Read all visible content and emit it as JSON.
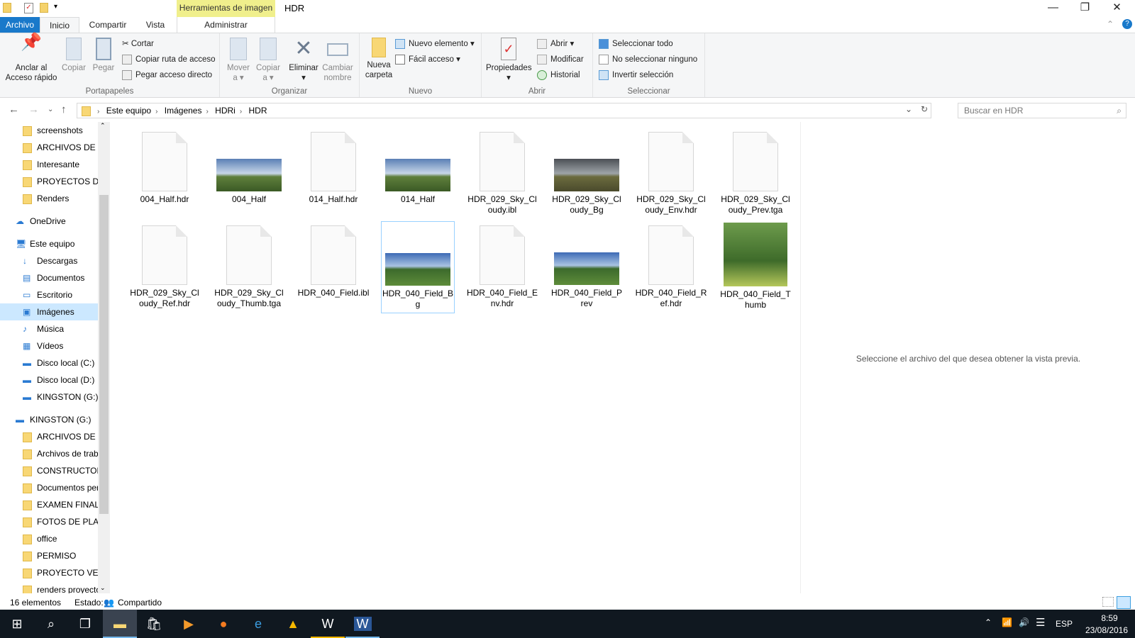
{
  "window": {
    "title": "HDR",
    "context_tab": "Herramientas de imagen",
    "min": "—",
    "max": "❐",
    "close": "✕"
  },
  "tabs": [
    {
      "label": "Archivo"
    },
    {
      "label": "Inicio"
    },
    {
      "label": "Compartir"
    },
    {
      "label": "Vista"
    },
    {
      "label": "Administrar"
    }
  ],
  "ribbon": {
    "portapapeles": {
      "label": "Portapapeles",
      "pin": "Anclar al\nAcceso rápido",
      "copy": "Copiar",
      "paste": "Pegar",
      "cut": "Cortar",
      "copy_path": "Copiar ruta de acceso",
      "paste_shortcut": "Pegar acceso directo"
    },
    "organizar": {
      "label": "Organizar",
      "move": "Mover\na ▾",
      "copy_to": "Copiar\na ▾",
      "delete": "Eliminar\n▾",
      "rename": "Cambiar\nnombre"
    },
    "nuevo": {
      "label": "Nuevo",
      "new_folder": "Nueva\ncarpeta",
      "new_item": "Nuevo elemento ▾",
      "easy_access": "Fácil acceso ▾"
    },
    "abrir": {
      "label": "Abrir",
      "properties": "Propiedades\n▾",
      "open": "Abrir ▾",
      "edit": "Modificar",
      "history": "Historial"
    },
    "seleccionar": {
      "label": "Seleccionar",
      "all": "Seleccionar todo",
      "none": "No seleccionar ninguno",
      "invert": "Invertir selección"
    }
  },
  "address": {
    "crumbs": [
      "Este equipo",
      "Imágenes",
      "HDRi",
      "HDR"
    ],
    "search_placeholder": "Buscar en HDR"
  },
  "nav": [
    {
      "label": "screenshots",
      "type": "folder",
      "indent": 1
    },
    {
      "label": "ARCHIVOS DE PI",
      "type": "folder",
      "indent": 1
    },
    {
      "label": "Interesante",
      "type": "folder",
      "indent": 1
    },
    {
      "label": "PROYECTOS DE T",
      "type": "folder",
      "indent": 1
    },
    {
      "label": "Renders",
      "type": "folder",
      "indent": 1
    },
    {
      "label": "OneDrive",
      "type": "cloud",
      "indent": 0,
      "gap": true
    },
    {
      "label": "Este equipo",
      "type": "pc",
      "indent": 0,
      "gap": true
    },
    {
      "label": "Descargas",
      "type": "down",
      "indent": 1
    },
    {
      "label": "Documentos",
      "type": "doc",
      "indent": 1
    },
    {
      "label": "Escritorio",
      "type": "desk",
      "indent": 1
    },
    {
      "label": "Imágenes",
      "type": "pics",
      "indent": 1,
      "selected": true
    },
    {
      "label": "Música",
      "type": "music",
      "indent": 1
    },
    {
      "label": "Vídeos",
      "type": "video",
      "indent": 1
    },
    {
      "label": "Disco local (C:)",
      "type": "drive",
      "indent": 1
    },
    {
      "label": "Disco local (D:)",
      "type": "drive",
      "indent": 1
    },
    {
      "label": "KINGSTON (G:)",
      "type": "drive",
      "indent": 1
    },
    {
      "label": "KINGSTON (G:)",
      "type": "drive",
      "indent": 0,
      "gap": true
    },
    {
      "label": "ARCHIVOS DE PI",
      "type": "folder",
      "indent": 1
    },
    {
      "label": "Archivos de trab",
      "type": "folder",
      "indent": 1
    },
    {
      "label": "CONSTRUCTORA",
      "type": "folder",
      "indent": 1
    },
    {
      "label": "Documentos per",
      "type": "folder",
      "indent": 1
    },
    {
      "label": "EXAMEN FINAL",
      "type": "folder",
      "indent": 1
    },
    {
      "label": "FOTOS DE PLAN",
      "type": "folder",
      "indent": 1
    },
    {
      "label": "office",
      "type": "folder",
      "indent": 1
    },
    {
      "label": "PERMISO",
      "type": "folder",
      "indent": 1
    },
    {
      "label": "PROYECTO VENT",
      "type": "folder",
      "indent": 1
    },
    {
      "label": "renders proyecto",
      "type": "folder",
      "indent": 1
    }
  ],
  "files": [
    {
      "name": "004_Half.hdr",
      "kind": "doc"
    },
    {
      "name": "004_Half",
      "kind": "pano"
    },
    {
      "name": "014_Half.hdr",
      "kind": "doc"
    },
    {
      "name": "014_Half",
      "kind": "pano"
    },
    {
      "name": "HDR_029_Sky_Cloudy.ibl",
      "kind": "doc"
    },
    {
      "name": "HDR_029_Sky_Cloudy_Bg",
      "kind": "cloudy"
    },
    {
      "name": "HDR_029_Sky_Cloudy_Env.hdr",
      "kind": "doc"
    },
    {
      "name": "HDR_029_Sky_Cloudy_Prev.tga",
      "kind": "doc"
    },
    {
      "name": "HDR_029_Sky_Cloudy_Ref.hdr",
      "kind": "doc"
    },
    {
      "name": "HDR_029_Sky_Cloudy_Thumb.tga",
      "kind": "doc"
    },
    {
      "name": "HDR_040_Field.ibl",
      "kind": "doc"
    },
    {
      "name": "HDR_040_Field_Bg",
      "kind": "field",
      "selected": true
    },
    {
      "name": "HDR_040_Field_Env.hdr",
      "kind": "doc"
    },
    {
      "name": "HDR_040_Field_Prev",
      "kind": "field"
    },
    {
      "name": "HDR_040_Field_Ref.hdr",
      "kind": "doc"
    },
    {
      "name": "HDR_040_Field_Thumb",
      "kind": "tall"
    }
  ],
  "preview_text": "Seleccione el archivo del que desea obtener la vista previa.",
  "status": {
    "count": "16 elementos",
    "state_label": "Estado:",
    "state": "Compartido"
  },
  "tray": {
    "lang": "ESP",
    "time": "8:59",
    "date": "23/08/2016"
  }
}
